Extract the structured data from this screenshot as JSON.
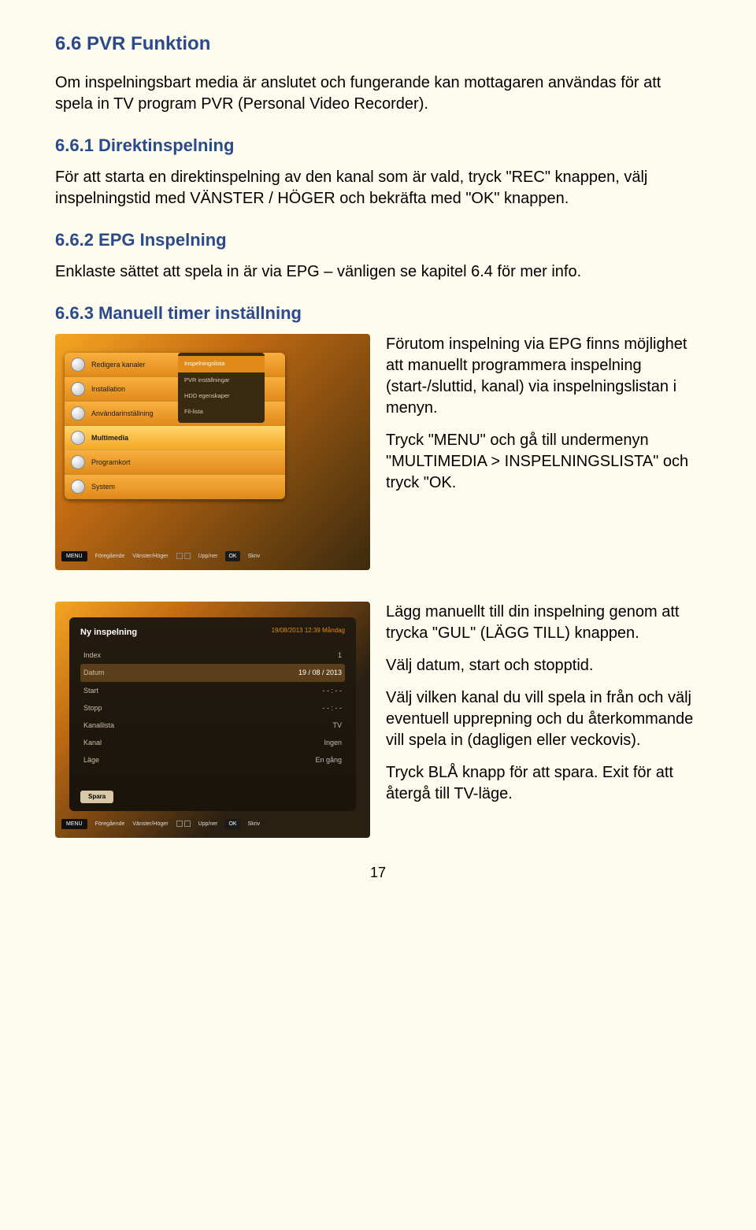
{
  "section": {
    "h2": "6.6  PVR Funktion",
    "intro": "Om inspelningsbart media är anslutet och fungerande kan mottagaren användas för att spela in TV program PVR (Personal Video Recorder).",
    "s1": {
      "h": "6.6.1  Direktinspelning",
      "p": "För att starta en direktinspelning av den kanal som är vald, tryck \"REC\" knappen, välj inspelningstid med VÄNSTER / HÖGER och bekräfta med \"OK\" knappen."
    },
    "s2": {
      "h": "6.6.2  EPG Inspelning",
      "p": "Enklaste sättet att spela in är via EPG – vänligen se kapitel 6.4 för mer info."
    },
    "s3": {
      "h": "6.6.3  Manuell timer inställning",
      "p1": "Förutom inspelning via EPG finns möjlighet att manuellt programmera inspelning (start-/sluttid, kanal) via inspelningslistan i menyn.",
      "p2": "Tryck \"MENU\" och gå till undermenyn \"MULTIMEDIA > INSPELNINGSLISTA\" och tryck \"OK."
    },
    "s4": {
      "p1": "Lägg manuellt till din inspelning genom att trycka \"GUL\" (LÄGG TILL) knappen.",
      "p2": "Välj datum, start och stopptid.",
      "p3": "Välj vilken kanal du vill spela in från och välj eventuell upprepning och du återkommande vill spela in (dagligen eller veckovis).",
      "p4": "Tryck BLÅ knapp för att spara. Exit för att återgå till TV-läge."
    }
  },
  "menu_shot": {
    "items": [
      {
        "label": "Redigera kanaler"
      },
      {
        "label": "Installation"
      },
      {
        "label": "Användarinställning"
      },
      {
        "label": "Multimedia"
      },
      {
        "label": "Programkort"
      },
      {
        "label": "System"
      }
    ],
    "submenu": [
      {
        "label": "Inspelningslista",
        "sel": true
      },
      {
        "label": "PVR inställningar"
      },
      {
        "label": "HDD egenskaper"
      },
      {
        "label": "Fil-lista"
      }
    ],
    "footer": {
      "menu": "MENU",
      "prev": "Föregående",
      "lr": "Vänster/Höger",
      "ud": "Upp/ner",
      "ok": "OK",
      "skriv": "Skriv"
    }
  },
  "form_shot": {
    "title": "Ny inspelning",
    "date": "19/08/2013 12:39 Måndag",
    "rows": [
      {
        "k": "Index",
        "v": "1"
      },
      {
        "k": "Datum",
        "v": "19 / 08 / 2013",
        "hi": true
      },
      {
        "k": "Start",
        "v": "- - : - -"
      },
      {
        "k": "Stopp",
        "v": "- - : - -"
      },
      {
        "k": "Kanallista",
        "v": "TV"
      },
      {
        "k": "Kanal",
        "v": "Ingen"
      },
      {
        "k": "Läge",
        "v": "En gång"
      }
    ],
    "spara": "Spara",
    "footer": {
      "menu": "MENU",
      "prev": "Föregående",
      "lr": "Vänster/Höger",
      "ud": "Upp/ner",
      "ok": "OK",
      "skriv": "Skriv"
    }
  },
  "page": "17"
}
